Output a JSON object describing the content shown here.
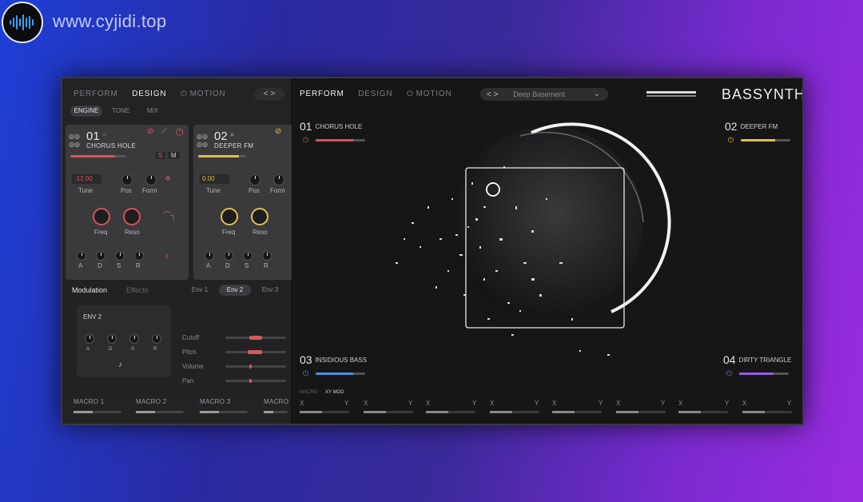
{
  "watermark": {
    "text": "www.cyjidi.top"
  },
  "left": {
    "nav": [
      "PERFORM",
      "DESIGN",
      "MOTION"
    ],
    "arrows": "< >",
    "subtabs": [
      "ENGINE",
      "TONE",
      "MIX"
    ],
    "slot1": {
      "num": "01",
      "name": "CHORUS HOLE",
      "mini": [
        "S",
        "M"
      ],
      "tune_value": "-12.00",
      "labels": {
        "tune": "Tune",
        "pos": "Pos",
        "form": "Form",
        "freq": "Freq",
        "reso": "Reso"
      },
      "env": [
        "A",
        "D",
        "S",
        "R"
      ]
    },
    "slot2": {
      "num": "02",
      "name": "DEEPER FM",
      "tune_value": "0.00",
      "labels": {
        "tune": "Tune",
        "pos": "Pos",
        "form": "Form",
        "freq": "Freq",
        "reso": "Reso"
      },
      "env": [
        "A",
        "D",
        "S",
        "R"
      ]
    },
    "modulation": {
      "tabs": [
        "Modulation",
        "Effects"
      ],
      "env_tabs": [
        "Env 1",
        "Env 2",
        "Env 3"
      ],
      "env_title": "ENV 2",
      "env": [
        "A",
        "D",
        "S",
        "R"
      ],
      "rows": [
        {
          "label": "Cutoff"
        },
        {
          "label": "Pitch"
        },
        {
          "label": "Volume"
        },
        {
          "label": "Pan"
        }
      ]
    },
    "macros": [
      "MACRO 1",
      "MACRO 2",
      "MACRO 3",
      "MACRO"
    ]
  },
  "right": {
    "nav": [
      "PERFORM",
      "DESIGN",
      "MOTION"
    ],
    "arrows": "< >",
    "preset": "Deep Basement",
    "logo": "BASSYNTH",
    "layers": [
      {
        "num": "01",
        "name": "CHORUS HOLE",
        "color": "#d9525a",
        "level": 0.75
      },
      {
        "num": "02",
        "name": "DEEPER FM",
        "color": "#e0c14a",
        "level": 0.7
      },
      {
        "num": "03",
        "name": "INSIDIOUS BASS",
        "color": "#4a8fe0",
        "level": 0.75
      },
      {
        "num": "04",
        "name": "DIRTY TRIANGLE",
        "color": "#9a5ce0",
        "level": 0.7
      }
    ],
    "bottom_tabs": [
      "MACRO",
      "XY MOD"
    ],
    "xy_slots": [
      "X",
      "Y",
      "X",
      "Y",
      "X",
      "Y",
      "X",
      "Y",
      "X",
      "Y",
      "X",
      "Y",
      "X",
      "Y",
      "X",
      "Y"
    ]
  },
  "colors": {
    "red": "#d9525a",
    "yellow": "#e0c14a",
    "blue": "#4a8fe0",
    "purple": "#9a5ce0"
  }
}
